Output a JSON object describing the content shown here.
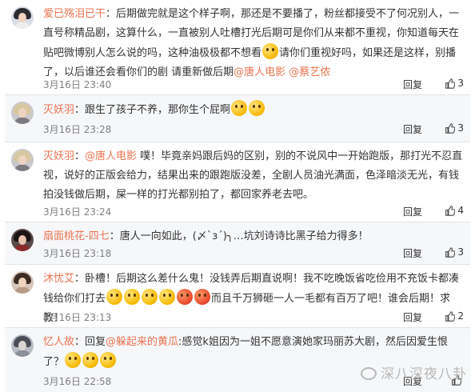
{
  "comments": [
    {
      "author": "爱已殇泪已干",
      "body_1": "：后期做完就是这个样子啊，那还是不要播了，粉丝都接受不了何况别人，一直号称精品剧，这算什么，一直被别人吐槽打光后期可是你们从来都不重视，你知道每天在贴吧微博别人怎么说的吗，这种油极极都不想看",
      "body_2": "请你们重视好吗，如果还是这样，别播了，以后谁还会看你们的剧 请重新做后期",
      "mention_1": "@唐人电影",
      "mention_2": "@蔡艺侬",
      "time": "3月16日 23:40",
      "reply": "回复",
      "likes": "3"
    },
    {
      "author": "灭妖羽",
      "body_1": "：跟生了孩子不养，那你生个屁啊",
      "time": "3月16日 23:28",
      "reply": "回复",
      "likes": "3"
    },
    {
      "author": "灭妖羽",
      "mention_1": "@唐人电影",
      "body_1": "：",
      "body_2": " 噗！毕竟亲妈跟后妈的区别，别的不说风中一开始跑版，那打光不忍直视，说好的正版会给力，结果出来的跟跑版没差，全剧人员油光满面，色泽暗淡无光，有钱拍没钱做后期，屎一样的打光都别拍了，都回家养老去吧。",
      "time": "3月16日 23:24",
      "reply": "回复",
      "likes": "4"
    },
    {
      "author": "扇面桃花-四七",
      "body_1": "：唐人一向如此，(〆`з´)╮…坑刘诗诗比黑子给力得多！",
      "time": "3月16日 23:18",
      "reply": "回复",
      "likes": "3"
    },
    {
      "author": "沐忧艾",
      "body_1": "：卧槽！后期这么差什么鬼！没钱弄后期直说啊！我不吃晚饭省吃俭用不充饭卡都凑钱给你们打去",
      "body_2": "而且千万狮砸一人一毛都有百万了吧！谁会后期！求教！",
      "time": "3月16日 23:13",
      "reply": "回复",
      "likes": "2"
    },
    {
      "author": "忆人故",
      "body_1": "：回复",
      "mention_1": "@躲起来的黄瓜",
      "body_2": ":感觉k姐因为一姐不愿意演她家玛丽苏大剧，然后因爱生恨了？",
      "time": "3月16日 22:58",
      "reply": "回复",
      "likes": ""
    }
  ],
  "watermark": "深八深夜八卦",
  "colors": {
    "author": "#eb7350",
    "meta": "#808080",
    "divider": "#e4e4e4"
  },
  "icons": {
    "like": "thumbs-up-icon",
    "emoji": "emoji-icon"
  }
}
